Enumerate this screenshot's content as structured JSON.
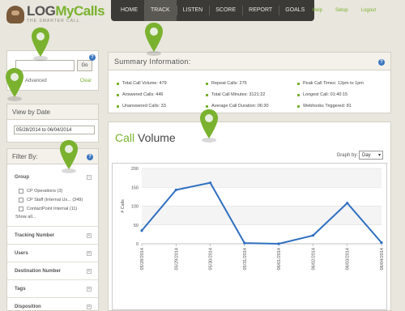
{
  "app": {
    "logo_prefix": "LOG",
    "logo_brand": "MyCalls",
    "tagline": "THE SMARTER CALL"
  },
  "nav": {
    "items": [
      "HOME",
      "TRACK",
      "LISTEN",
      "SCORE",
      "REPORT",
      "GOALS"
    ],
    "active": "TRACK"
  },
  "top_links": [
    "Help",
    "Setup",
    "Logout"
  ],
  "search": {
    "go_label": "Go",
    "advanced_label": "Advanced",
    "clear_label": "Clear",
    "info_icon": "?"
  },
  "date": {
    "title": "View by Date",
    "range": "05/28/2014 to 06/04/2014"
  },
  "filter": {
    "title": "Filter By:",
    "group_label": "Group",
    "group_items": [
      "CP Operations (3)",
      "CP Staff (Internal Us... (349)",
      "ContactPoint Internal (11)"
    ],
    "show_all": "Show all...",
    "collapse_glyph": "–",
    "expand_glyph": "+",
    "rows": [
      "Tracking Number",
      "Users",
      "Destination Number",
      "Tags",
      "Disposition"
    ]
  },
  "summary": {
    "title": "Summary Information:",
    "col1": [
      "Total Call Volume: 479",
      "Answered Calls: 446",
      "Unanswered Calls: 33"
    ],
    "col2": [
      "Repeat Calls: 275",
      "Total Call Minutes: 3121:22",
      "Average Call Duration: 06:30"
    ],
    "col3": [
      "Peak Call Times: 12pm to 1pm",
      "Longest Call: 01:40:15",
      "Webhooks Triggered: 81"
    ]
  },
  "chart_panel": {
    "title_highlight": "Call",
    "title_rest": " Volume",
    "graph_by_label": "Graph by:",
    "graph_by_value": "Day"
  },
  "colors": {
    "accent": "#7ab22f",
    "nav_bg": "#3b3a36",
    "line": "#2f6fc0",
    "pin": "#7ab22f"
  },
  "chart_data": {
    "type": "line",
    "categories": [
      "05/28/2014",
      "05/29/2014",
      "05/30/2014",
      "05/31/2014",
      "06/01/2014",
      "06/02/2014",
      "06/03/2014",
      "06/04/2014"
    ],
    "values": [
      35,
      143,
      162,
      2,
      0,
      22,
      108,
      3
    ],
    "ylabel": "# Calls",
    "ylim": [
      0,
      200
    ],
    "yticks": [
      0,
      50,
      100,
      150,
      200
    ],
    "grid": true
  }
}
